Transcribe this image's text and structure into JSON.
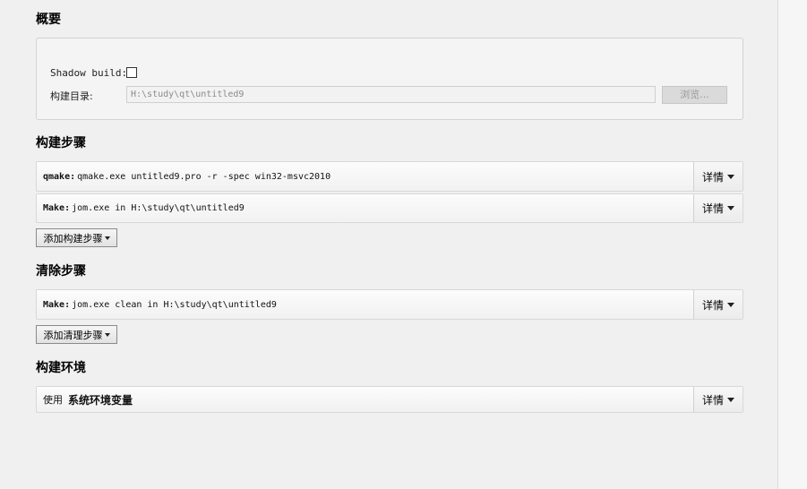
{
  "overview": {
    "title": "概要",
    "shadow_build_label": "Shadow build:",
    "shadow_build_checked": false,
    "build_dir_label": "构建目录:",
    "build_dir_value": "H:\\study\\qt\\untitled9",
    "browse_label": "浏览..."
  },
  "build_steps": {
    "title": "构建步骤",
    "steps": [
      {
        "name": "qmake:",
        "detail": "qmake.exe untitled9.pro -r -spec win32-msvc2010"
      },
      {
        "name": "Make:",
        "detail": "jom.exe in H:\\study\\qt\\untitled9"
      }
    ],
    "add_label": "添加构建步骤"
  },
  "clean_steps": {
    "title": "清除步骤",
    "steps": [
      {
        "name": "Make:",
        "detail": "jom.exe clean in H:\\study\\qt\\untitled9"
      }
    ],
    "add_label": "添加清理步骤"
  },
  "build_env": {
    "title": "构建环境",
    "prefix": "使用",
    "value": "系统环境变量"
  },
  "details_label": "详情"
}
